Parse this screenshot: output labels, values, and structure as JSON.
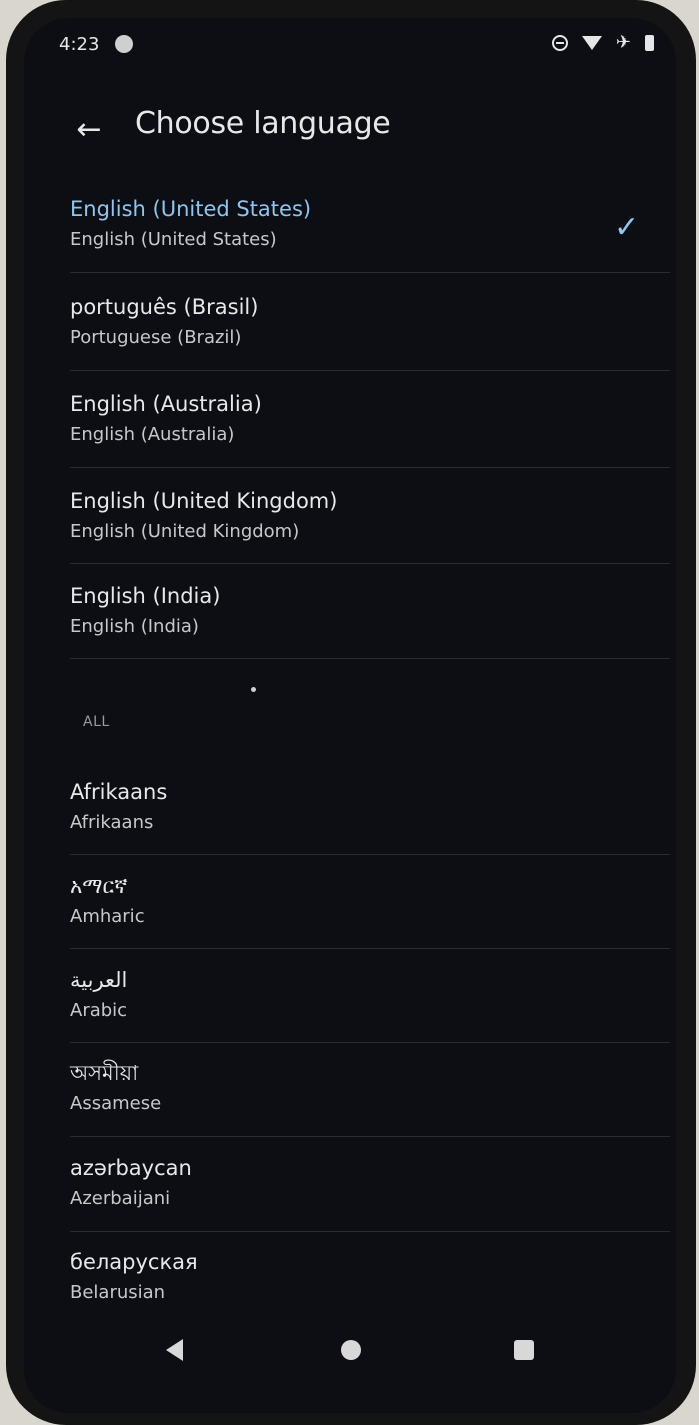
{
  "status_bar": {
    "time": "4:23"
  },
  "app_bar": {
    "title": "Choose language",
    "back_icon": "←"
  },
  "selected_icon": "✓",
  "suggested": [
    {
      "name": "English (United States)",
      "sub": "English (United States)"
    },
    {
      "name": "português (Brasil)",
      "sub": "Portuguese (Brazil)"
    },
    {
      "name": "English (Australia)",
      "sub": "English (Australia)"
    },
    {
      "name": "English (United Kingdom)",
      "sub": "English (United Kingdom)"
    },
    {
      "name": "English (India)",
      "sub": "English (India)"
    }
  ],
  "section_label": "ALL",
  "all": [
    {
      "name": "Afrikaans",
      "sub": "Afrikaans"
    },
    {
      "name": "አማርኛ",
      "sub": "Amharic"
    },
    {
      "name": "العربية",
      "sub": "Arabic"
    },
    {
      "name": "অসমীয়া",
      "sub": "Assamese"
    },
    {
      "name": "azərbaycan",
      "sub": "Azerbaijani"
    },
    {
      "name": "беларуская",
      "sub": "Belarusian"
    }
  ],
  "colors": {
    "accent": "#8cc7ef",
    "background": "#0d0e13"
  }
}
